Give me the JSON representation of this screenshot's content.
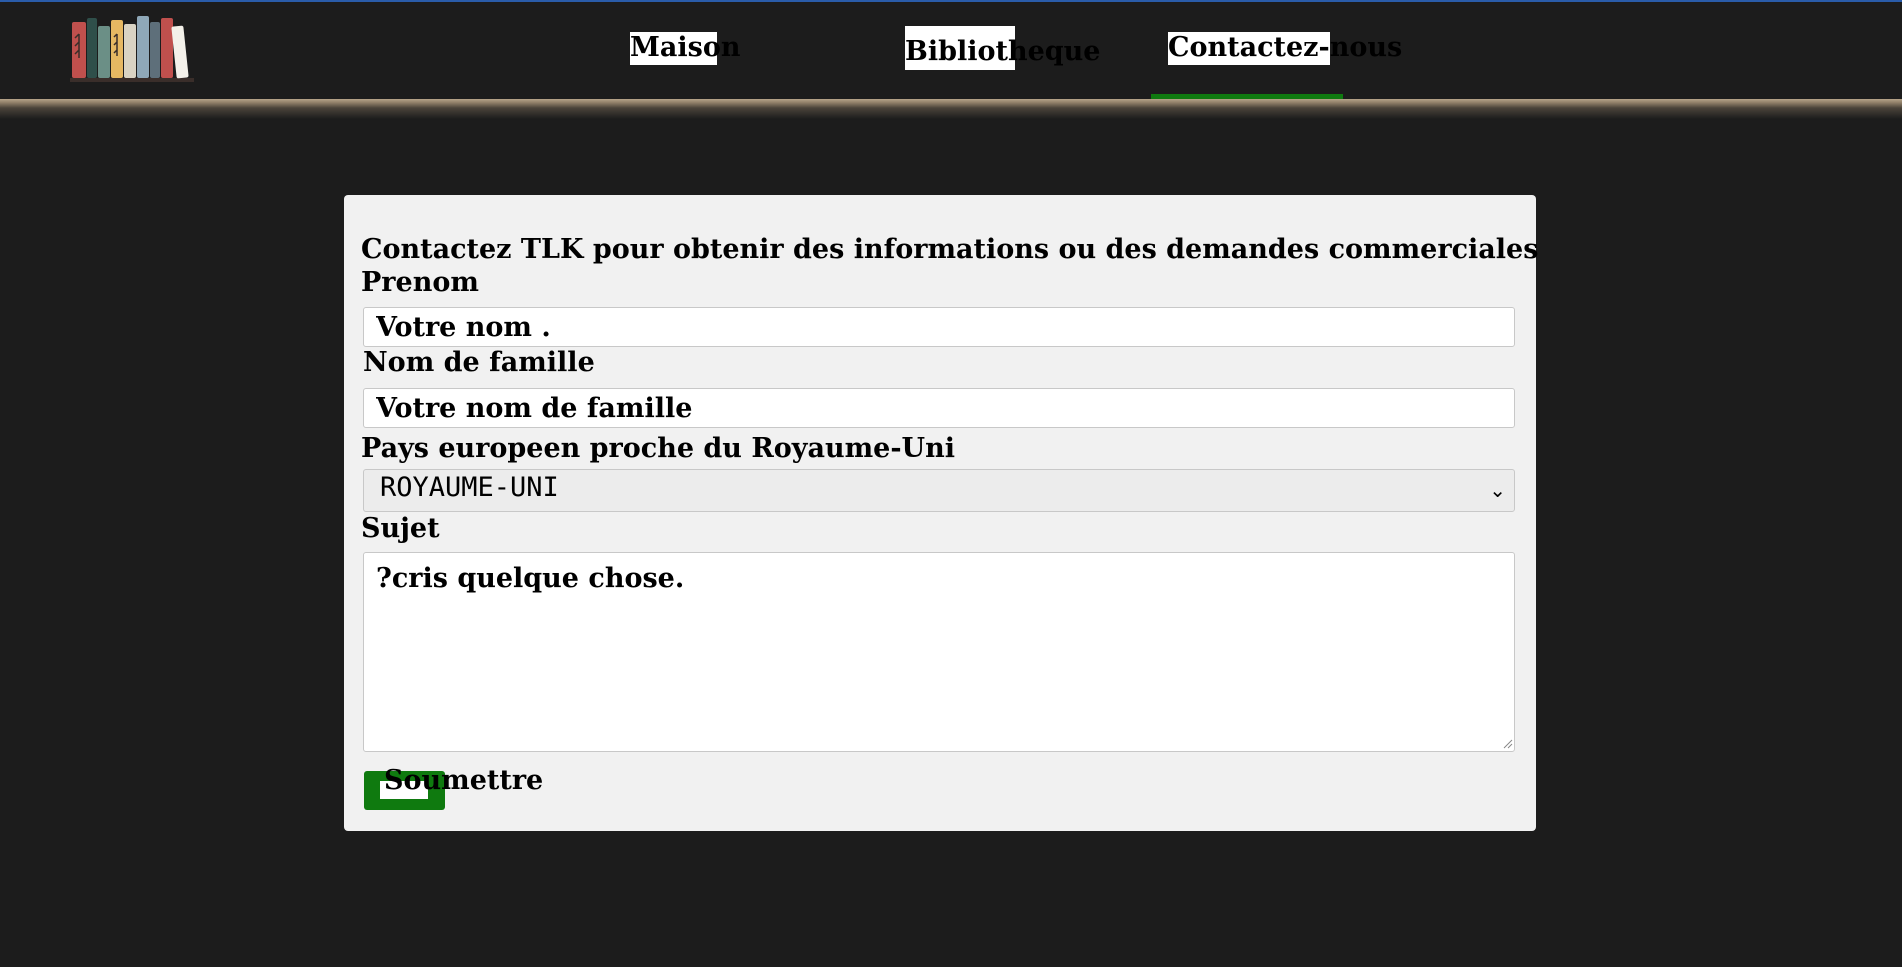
{
  "nav": {
    "links": [
      {
        "label": "Maison"
      },
      {
        "label": "Bibliotheque"
      },
      {
        "label": "Contactez-nous",
        "active": true
      }
    ],
    "active_color": "#0f7a0f",
    "logo_icon": "books-shelf-icon"
  },
  "form": {
    "heading": "Contactez TLK pour obtenir des informations ou des demandes commerciales",
    "first_name": {
      "label": "Prenom",
      "placeholder": "Votre nom ."
    },
    "last_name": {
      "label": "Nom de famille",
      "placeholder": "Votre nom de famille"
    },
    "country": {
      "label": "Pays europeen proche du Royaume-Uni",
      "selected": "ROYAUME-UNI"
    },
    "subject": {
      "label": "Sujet",
      "placeholder": "?cris quelque chose."
    },
    "submit_label": "Soumettre",
    "submit_color": "#0f7a0f"
  },
  "colors": {
    "page_bg": "#1c1c1c",
    "card_bg": "#f1f1f1",
    "top_line": "#2a5caa"
  }
}
